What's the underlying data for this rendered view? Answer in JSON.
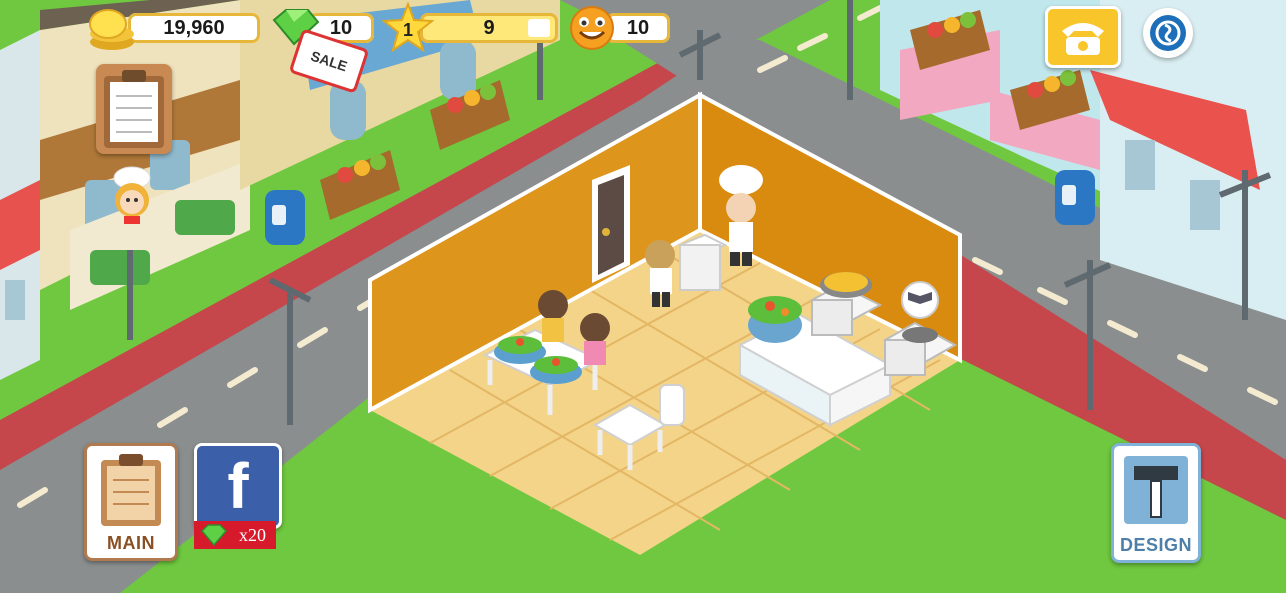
{
  "hud": {
    "coins": "19,960",
    "gems": "10",
    "level": "1",
    "xp": "9",
    "happiness": "10"
  },
  "sale_label": "SALE",
  "buttons": {
    "main_label": "MAIN",
    "design_label": "DESIGN",
    "facebook_reward": "x20",
    "facebook_glyph": "f"
  },
  "icons": {
    "coins": "coin-stack-icon",
    "gems": "gem-icon",
    "level": "star-icon",
    "happiness": "smiley-icon",
    "phone": "phone-icon",
    "social": "social-network-icon",
    "orders": "clipboard-icon",
    "chef": "chef-avatar-icon",
    "recipe": "recipe-book-icon"
  },
  "colors": {
    "grass": "#6fc83f",
    "road": "#8a8e8f",
    "sidewalk": "#c5464b",
    "wall": "#de951c",
    "floor": "#f3d489",
    "hud_gold": "#e7b73a"
  }
}
